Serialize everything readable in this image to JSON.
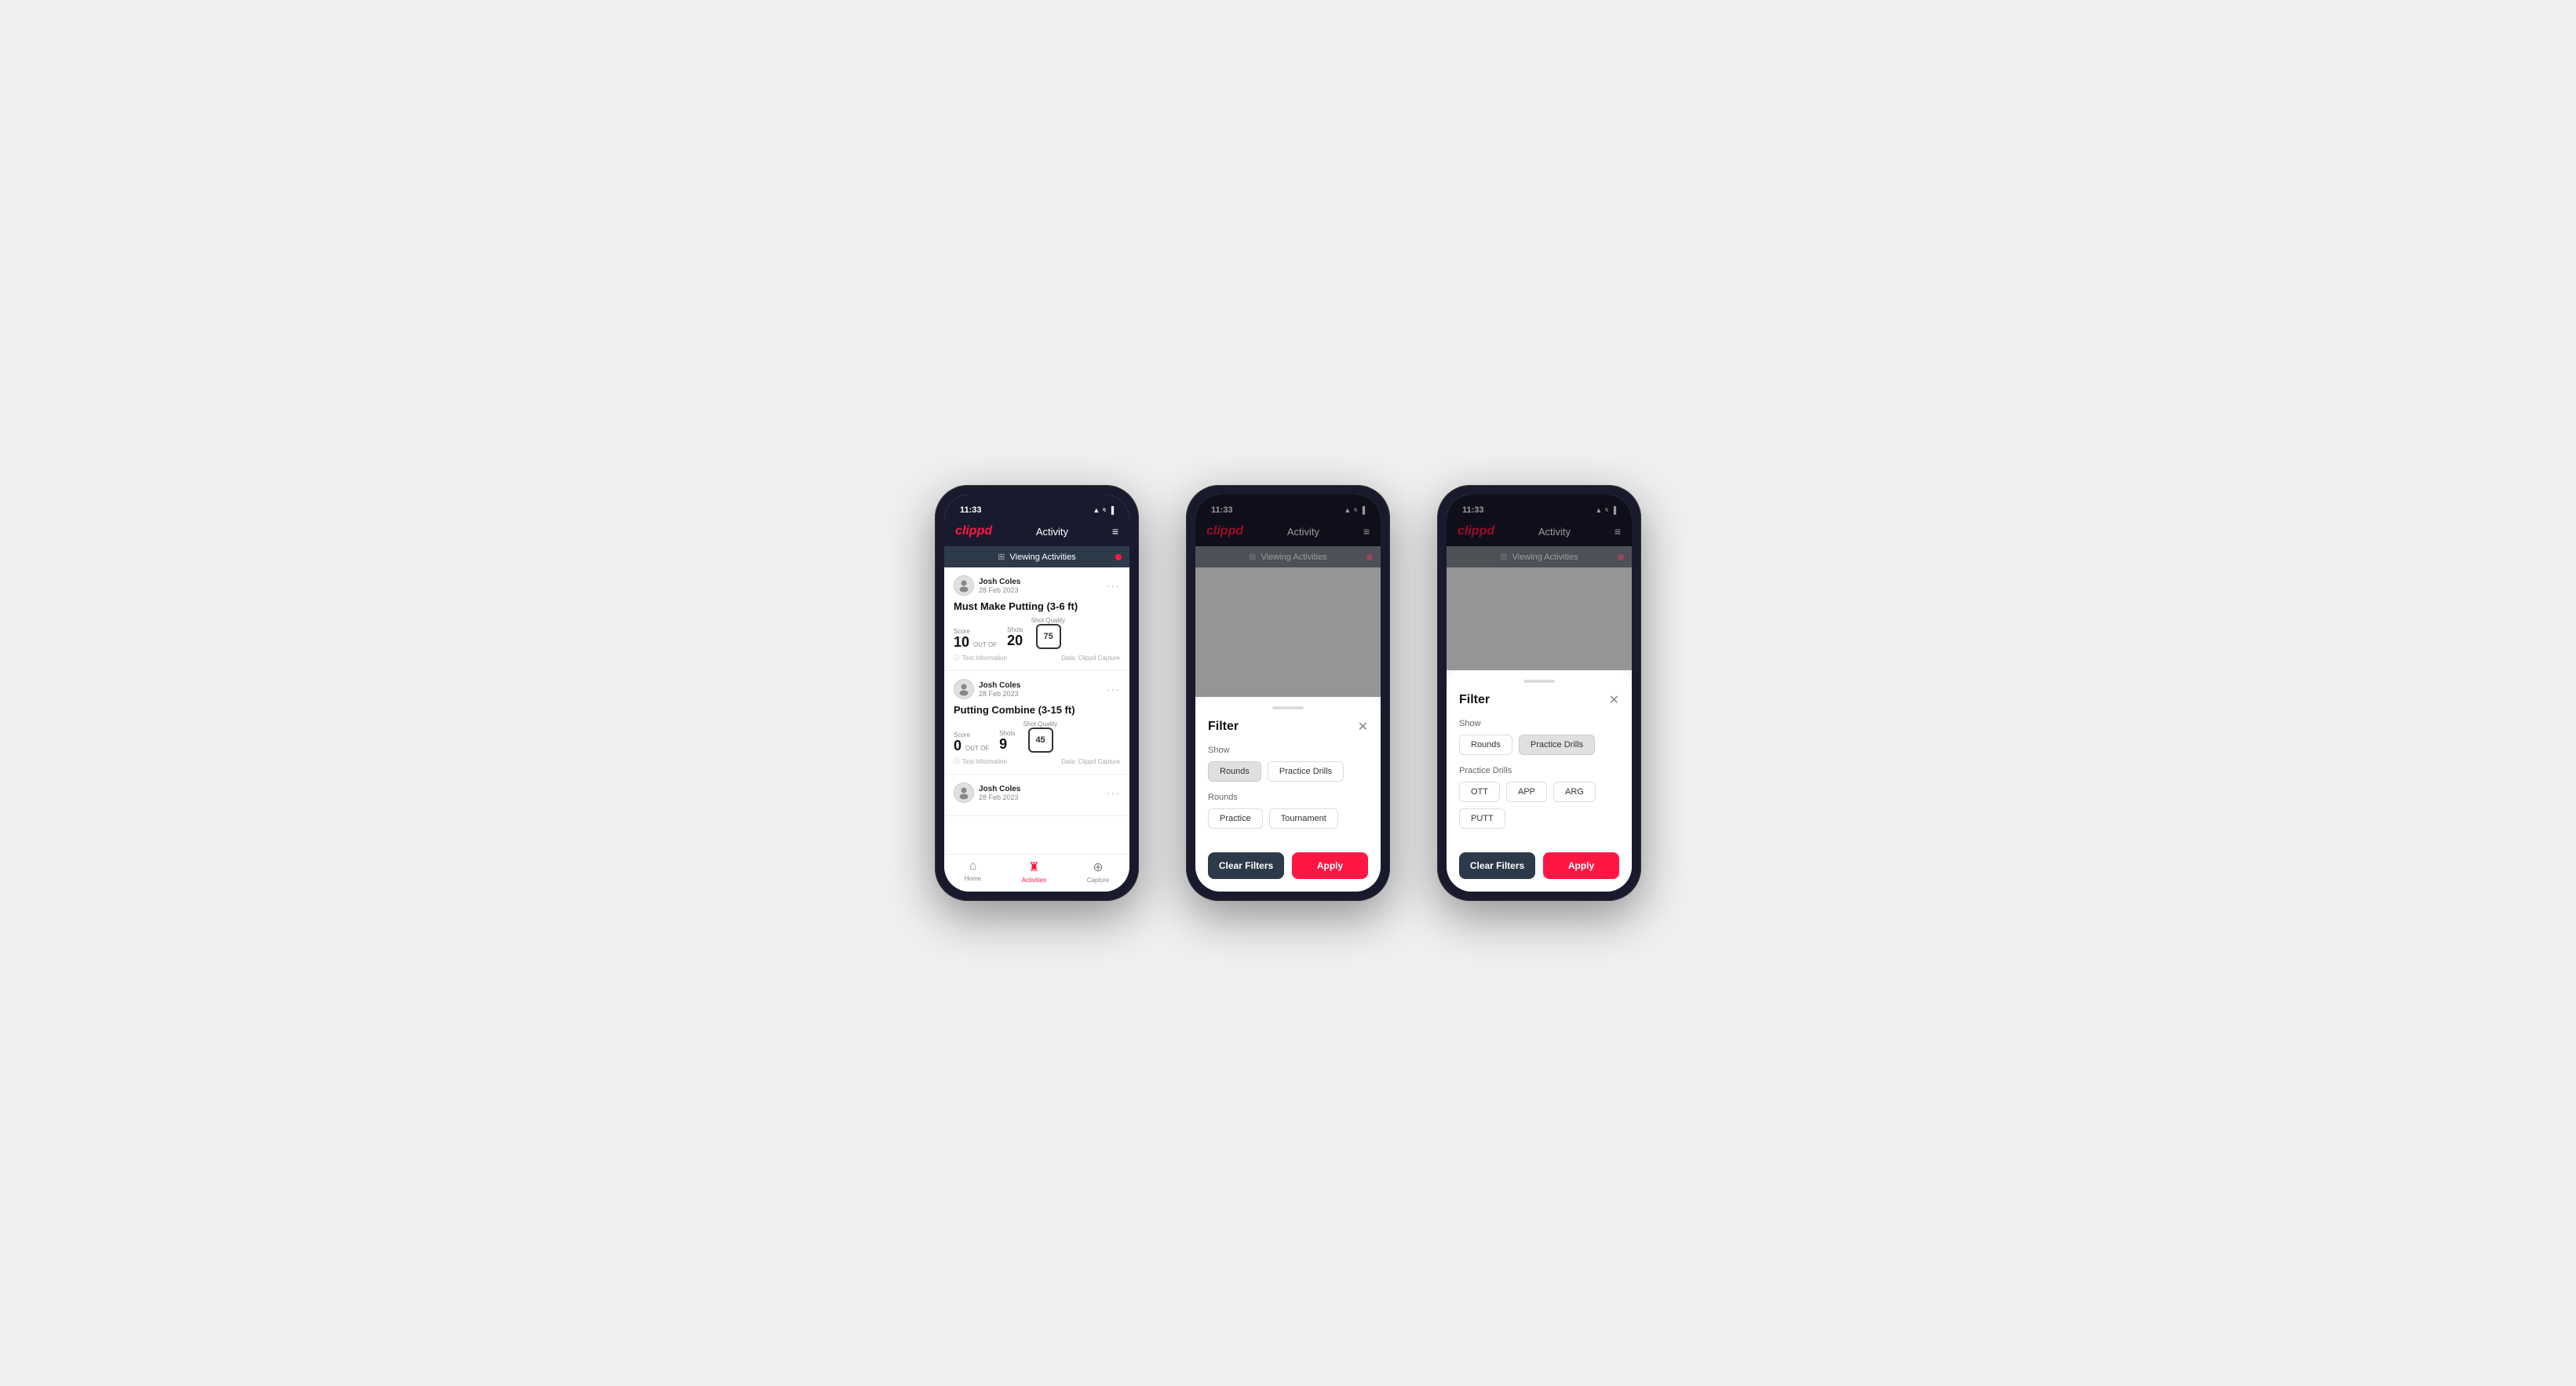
{
  "app": {
    "logo": "clippd",
    "header_title": "Activity",
    "status_time": "11:33",
    "status_icons": "▲ ᵑ ▐"
  },
  "viewing_bar": {
    "text": "Viewing Activities",
    "icon": "⊞"
  },
  "phone1": {
    "activities": [
      {
        "user_name": "Josh Coles",
        "user_date": "28 Feb 2023",
        "title": "Must Make Putting (3-6 ft)",
        "score_label": "Score",
        "score_value": "10",
        "shots_label": "Shots",
        "shots_value": "20",
        "shot_quality_label": "Shot Quality",
        "shot_quality_value": "75",
        "footer_left": "Test Information",
        "footer_right": "Data: Clippd Capture"
      },
      {
        "user_name": "Josh Coles",
        "user_date": "28 Feb 2023",
        "title": "Putting Combine (3-15 ft)",
        "score_label": "Score",
        "score_value": "0",
        "shots_label": "Shots",
        "shots_value": "9",
        "shot_quality_label": "Shot Quality",
        "shot_quality_value": "45",
        "footer_left": "Test Information",
        "footer_right": "Data: Clippd Capture"
      },
      {
        "user_name": "Josh Coles",
        "user_date": "28 Feb 2023",
        "title": "",
        "score_label": "",
        "score_value": "",
        "shots_label": "",
        "shots_value": "",
        "shot_quality_label": "",
        "shot_quality_value": "",
        "footer_left": "",
        "footer_right": ""
      }
    ],
    "nav": {
      "home_label": "Home",
      "activities_label": "Activities",
      "capture_label": "Capture"
    }
  },
  "phone2": {
    "filter": {
      "title": "Filter",
      "show_label": "Show",
      "rounds_btn": "Rounds",
      "practice_drills_btn": "Practice Drills",
      "rounds_section_label": "Rounds",
      "practice_btn": "Practice",
      "tournament_btn": "Tournament",
      "clear_filters_btn": "Clear Filters",
      "apply_btn": "Apply",
      "rounds_selected": true,
      "practice_drills_selected": false
    }
  },
  "phone3": {
    "filter": {
      "title": "Filter",
      "show_label": "Show",
      "rounds_btn": "Rounds",
      "practice_drills_btn": "Practice Drills",
      "practice_drills_section_label": "Practice Drills",
      "ott_btn": "OTT",
      "app_btn": "APP",
      "arg_btn": "ARG",
      "putt_btn": "PUTT",
      "clear_filters_btn": "Clear Filters",
      "apply_btn": "Apply",
      "rounds_selected": false,
      "practice_drills_selected": true
    }
  }
}
